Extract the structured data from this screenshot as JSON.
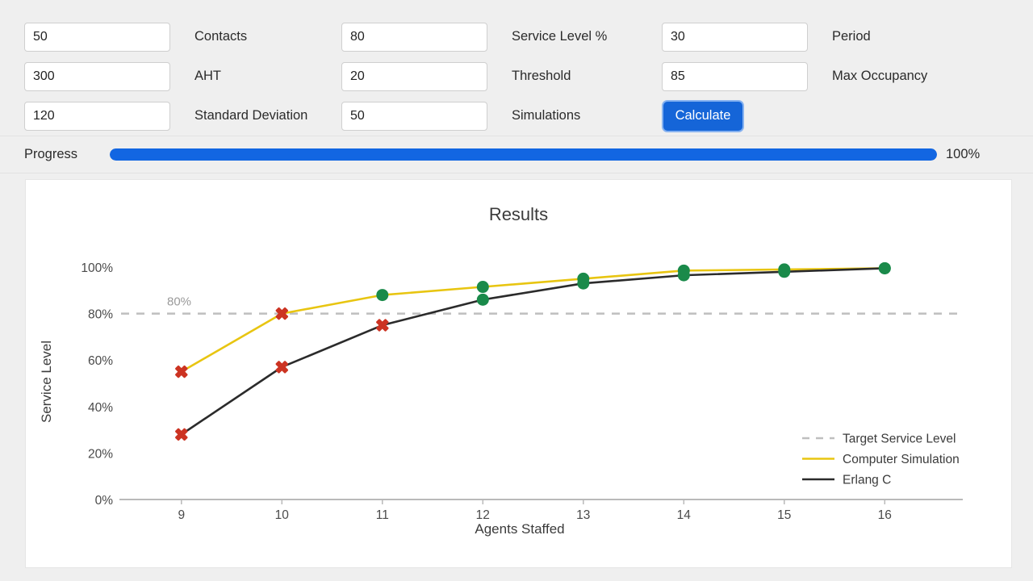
{
  "form": {
    "rows": [
      {
        "value": "50",
        "label": "Contacts",
        "value2": "80",
        "label2": "Service Level %",
        "value3": "30",
        "label3": "Period"
      },
      {
        "value": "300",
        "label": "AHT",
        "value2": "20",
        "label2": "Threshold",
        "value3": "85",
        "label3": "Max Occupancy"
      },
      {
        "value": "120",
        "label": "Standard Deviation",
        "value2": "50",
        "label2": "Simulations",
        "value3": "",
        "label3": ""
      }
    ],
    "calculate_label": "Calculate",
    "placeholder": ""
  },
  "progress": {
    "label": "Progress",
    "value_text": "100%",
    "percent": 100,
    "fill_color": "#1266e2"
  },
  "chart_data": {
    "type": "line",
    "title": "Results",
    "xlabel": "Agents Staffed",
    "ylabel": "Service Level",
    "x": [
      9,
      10,
      11,
      12,
      13,
      14,
      15,
      16
    ],
    "xtick_labels": [
      "9",
      "10",
      "11",
      "12",
      "13",
      "14",
      "15",
      "16"
    ],
    "ytick_labels": [
      "0%",
      "20%",
      "40%",
      "60%",
      "80%",
      "100%"
    ],
    "ytick_values": [
      0,
      20,
      40,
      60,
      80,
      100
    ],
    "ylim": [
      0,
      108
    ],
    "xlim": [
      8.6,
      16.6
    ],
    "grid": false,
    "legend_position": "lower right",
    "target_line": {
      "value": 80,
      "label": "80%",
      "color": "#bfbfbf",
      "style": "dashed"
    },
    "marker_colors": {
      "below_target": "#cc3322",
      "at_target": "#1a8a4a"
    },
    "series": [
      {
        "name": "Target Service Level",
        "color": "#bfbfbf",
        "style": "dashed",
        "values": [
          80,
          80,
          80,
          80,
          80,
          80,
          80,
          80
        ]
      },
      {
        "name": "Computer Simulation",
        "color": "#e8c511",
        "style": "solid",
        "values": [
          55,
          80,
          88,
          91.5,
          95,
          98.5,
          99,
          99.5
        ],
        "marker_states": [
          "below",
          "below",
          "at",
          "at",
          "at",
          "at",
          "at",
          "at"
        ]
      },
      {
        "name": "Erlang C",
        "color": "#2b2b2b",
        "style": "solid",
        "values": [
          28,
          57,
          75,
          86,
          93,
          96.5,
          98,
          99.5
        ],
        "marker_states": [
          "below",
          "below",
          "below",
          "at",
          "at",
          "at",
          "at",
          "at"
        ]
      }
    ]
  }
}
